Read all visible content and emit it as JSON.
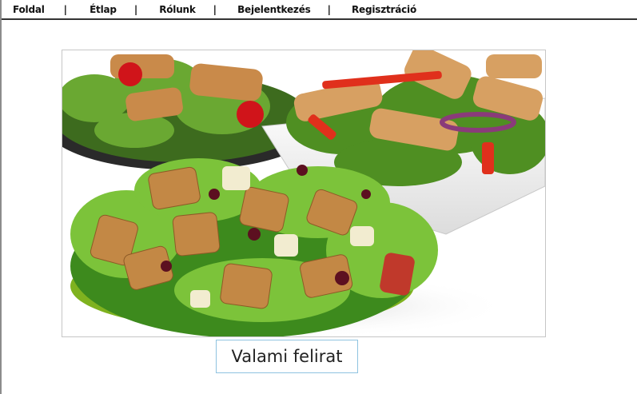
{
  "nav": {
    "items": [
      {
        "label": "Foldal"
      },
      {
        "label": "Étlap"
      },
      {
        "label": "Rólunk"
      },
      {
        "label": "Bejelentkezés"
      },
      {
        "label": "Regisztráció"
      }
    ],
    "separator": "|"
  },
  "main": {
    "image_alt": "salad-photo",
    "caption": "Valami felirat"
  },
  "colors": {
    "nav_border": "#333333",
    "caption_border": "#8fc3e0",
    "photo_border": "#c6c6c6"
  }
}
